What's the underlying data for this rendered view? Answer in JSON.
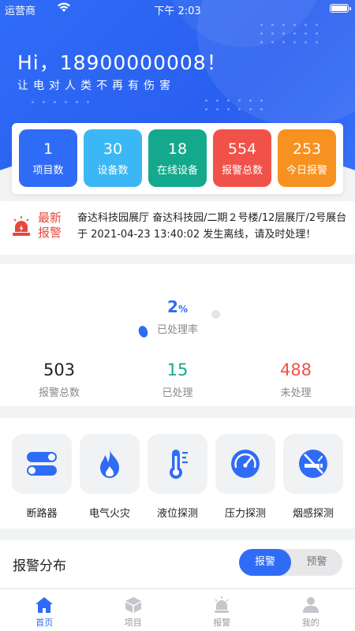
{
  "status_bar": {
    "carrier": "运营商",
    "time": "下午 2:03"
  },
  "header": {
    "greeting": "Hi，18900000008！",
    "slogan": "让电对人类不再有伤害"
  },
  "stats": [
    {
      "value": "1",
      "label": "项目数",
      "color": "#2f6cf6"
    },
    {
      "value": "30",
      "label": "设备数",
      "color": "#3cb7f5"
    },
    {
      "value": "18",
      "label": "在线设备",
      "color": "#14a98c"
    },
    {
      "value": "554",
      "label": "报警总数",
      "color": "#f0524a"
    },
    {
      "value": "253",
      "label": "今日报警",
      "color": "#f7911f"
    }
  ],
  "notice": {
    "tag": "最新报警",
    "message": "奋达科技园展厅 奋达科技园/二期２号楼/12层展厅/2号展台 于 2021-04-23 13:40:02 发生离线，请及时处理！"
  },
  "rate": {
    "value": "2",
    "unit": "%",
    "label": "已处理率"
  },
  "summary": [
    {
      "value": "503",
      "label": "报警总数",
      "color": "#222222"
    },
    {
      "value": "15",
      "label": "已处理",
      "color": "#14a98c"
    },
    {
      "value": "488",
      "label": "未处理",
      "color": "#f0524a"
    }
  ],
  "categories": [
    {
      "label": "断路器",
      "icon": "breaker-switch-icon"
    },
    {
      "label": "电气火灾",
      "icon": "fire-icon"
    },
    {
      "label": "液位探测",
      "icon": "thermometer-icon"
    },
    {
      "label": "压力探测",
      "icon": "gauge-icon"
    },
    {
      "label": "烟感探测",
      "icon": "no-smoking-icon"
    }
  ],
  "distribution": {
    "title": "报警分布",
    "tab_on": "报警",
    "tab_off": "预警"
  },
  "tabbar": [
    {
      "label": "首页",
      "icon": "home-icon",
      "active": true
    },
    {
      "label": "项目",
      "icon": "box-icon",
      "active": false
    },
    {
      "label": "报警",
      "icon": "alarm-icon",
      "active": false
    },
    {
      "label": "我的",
      "icon": "user-icon",
      "active": false
    }
  ],
  "colors": {
    "primary": "#2f6cf6",
    "danger": "#f0524a",
    "success": "#14a98c"
  }
}
